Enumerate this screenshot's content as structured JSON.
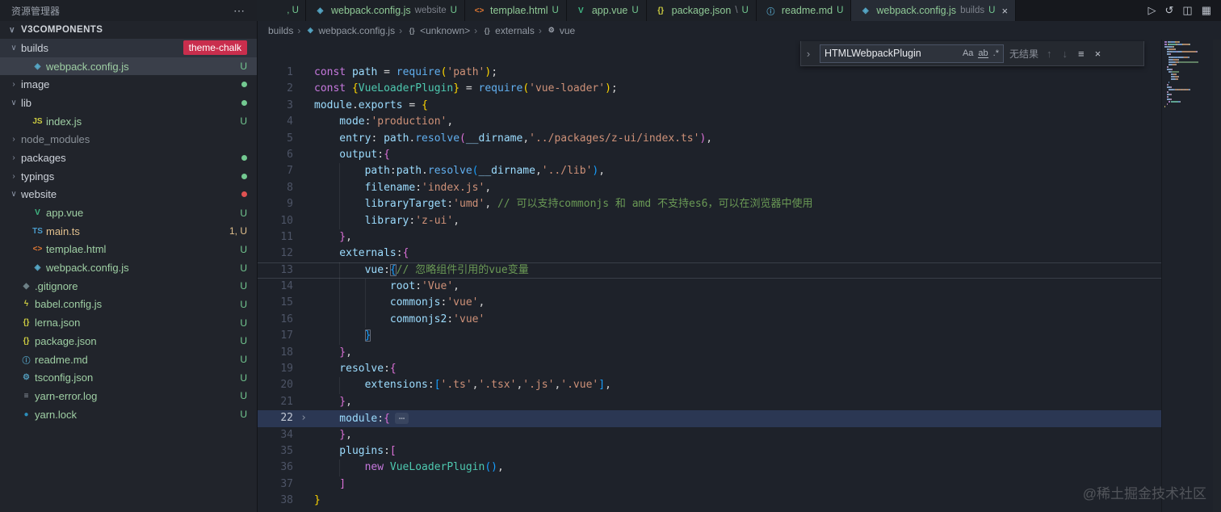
{
  "titlebar": {
    "explorer_title": "资源管理器",
    "more_icon": "⋯"
  },
  "icons_ui": {
    "chevron_down": "∨",
    "chevron_right": "›"
  },
  "icons": {
    "webpack": {
      "glyph": "◈",
      "color": "#56a8c7"
    },
    "html": {
      "glyph": "<>",
      "color": "#e37933"
    },
    "vue": {
      "glyph": "V",
      "color": "#41b883"
    },
    "js": {
      "glyph": "JS",
      "color": "#cbcb41"
    },
    "ts": {
      "glyph": "TS",
      "color": "#4a9ccc"
    },
    "json": {
      "glyph": "{}",
      "color": "#cbcb41"
    },
    "md": {
      "glyph": "ⓘ",
      "color": "#519aba"
    },
    "git": {
      "glyph": "◆",
      "color": "#6d8086"
    },
    "babel": {
      "glyph": "ϟ",
      "color": "#cbcb41"
    },
    "tsconfig": {
      "glyph": "⚙",
      "color": "#519aba"
    },
    "log": {
      "glyph": "≡",
      "color": "#8f98a3"
    },
    "lock": {
      "glyph": "●",
      "color": "#2c8ebb"
    },
    "sym": {
      "glyph": "{}",
      "color": "#8a9199"
    },
    "wrench": {
      "glyph": "⚙",
      "color": "#9aa0ab"
    }
  },
  "tabs": [
    {
      "name": "",
      "badge": ", U",
      "partial": true
    },
    {
      "icon": "webpack",
      "name": "webpack.config.js",
      "hint": "website",
      "badge": "U"
    },
    {
      "icon": "html",
      "name": "templae.html",
      "badge": "U"
    },
    {
      "icon": "vue",
      "name": "app.vue",
      "badge": "U"
    },
    {
      "icon": "json",
      "name": "package.json",
      "hint": "\\",
      "badge": "U"
    },
    {
      "icon": "md",
      "name": "readme.md",
      "badge": "U"
    },
    {
      "icon": "webpack",
      "name": "webpack.config.js",
      "hint": "builds",
      "badge": "U",
      "active": true,
      "close": "×"
    }
  ],
  "editor_actions": [
    {
      "name": "run",
      "glyph": "▷"
    },
    {
      "name": "history",
      "glyph": "↺"
    },
    {
      "name": "split-editor",
      "glyph": "◫"
    },
    {
      "name": "layout",
      "glyph": "▦"
    }
  ],
  "explorer": {
    "project": "V3COMPONENTS",
    "items": [
      {
        "kind": "folder",
        "name": "builds",
        "expanded": true,
        "hover": true,
        "label_badge": "theme-chalk"
      },
      {
        "kind": "file",
        "icon": "webpack",
        "name": "webpack.config.js",
        "badge": "U",
        "selected": true,
        "indent": 1
      },
      {
        "kind": "folder",
        "name": "image",
        "dot": "green"
      },
      {
        "kind": "folder",
        "name": "lib",
        "expanded": true,
        "dot": "green"
      },
      {
        "kind": "file",
        "icon": "js",
        "name": "index.js",
        "badge": "U",
        "indent": 1
      },
      {
        "kind": "folder",
        "name": "node_modules",
        "muted": true
      },
      {
        "kind": "folder",
        "name": "packages",
        "dot": "green"
      },
      {
        "kind": "folder",
        "name": "typings",
        "dot": "green"
      },
      {
        "kind": "folder",
        "name": "website",
        "expanded": true,
        "dot": "red"
      },
      {
        "kind": "file",
        "icon": "vue",
        "name": "app.vue",
        "badge": "U",
        "indent": 1
      },
      {
        "kind": "file",
        "icon": "ts",
        "name": "main.ts",
        "badge": "1, U",
        "warn": true,
        "indent": 1
      },
      {
        "kind": "file",
        "icon": "html",
        "name": "templae.html",
        "badge": "U",
        "indent": 1
      },
      {
        "kind": "file",
        "icon": "webpack",
        "name": "webpack.config.js",
        "badge": "U",
        "indent": 1
      },
      {
        "kind": "file",
        "icon": "git",
        "name": ".gitignore",
        "badge": "U"
      },
      {
        "kind": "file",
        "icon": "babel",
        "name": "babel.config.js",
        "badge": "U"
      },
      {
        "kind": "file",
        "icon": "json",
        "name": "lerna.json",
        "badge": "U"
      },
      {
        "kind": "file",
        "icon": "json",
        "name": "package.json",
        "badge": "U"
      },
      {
        "kind": "file",
        "icon": "md",
        "name": "readme.md",
        "badge": "U"
      },
      {
        "kind": "file",
        "icon": "tsconfig",
        "name": "tsconfig.json",
        "badge": "U"
      },
      {
        "kind": "file",
        "icon": "log",
        "name": "yarn-error.log",
        "badge": "U"
      },
      {
        "kind": "file",
        "icon": "lock",
        "name": "yarn.lock",
        "badge": "U"
      }
    ]
  },
  "breadcrumbs": {
    "separator": "›",
    "items": [
      {
        "label": "builds"
      },
      {
        "label": "webpack.config.js",
        "icon": "webpack"
      },
      {
        "label": "<unknown>",
        "icon": "sym"
      },
      {
        "label": "externals",
        "icon": "sym"
      },
      {
        "label": "vue",
        "icon": "wrench"
      }
    ]
  },
  "find": {
    "expand": "›",
    "query": "HTMLWebpackPlugin",
    "match_case": "Aa",
    "whole_word": "ab",
    "regex": ".*",
    "no_results": "无结果",
    "prev": "↑",
    "next": "↓",
    "in_selection": "≡",
    "close": "×"
  },
  "editor": {
    "lines": [
      {
        "n": 1,
        "ind": 0,
        "tokens": [
          [
            "kw",
            "const"
          ],
          [
            "pln",
            " "
          ],
          [
            "id",
            "path"
          ],
          [
            "pln",
            " = "
          ],
          [
            "fn",
            "require"
          ],
          [
            "b1",
            "("
          ],
          [
            "str",
            "'path'"
          ],
          [
            "b1",
            ")"
          ],
          [
            "pln",
            ";"
          ]
        ]
      },
      {
        "n": 2,
        "ind": 0,
        "tokens": [
          [
            "kw",
            "const"
          ],
          [
            "pln",
            " "
          ],
          [
            "b1",
            "{"
          ],
          [
            "cls",
            "VueLoaderPlugin"
          ],
          [
            "b1",
            "}"
          ],
          [
            "pln",
            " = "
          ],
          [
            "fn",
            "require"
          ],
          [
            "b1",
            "("
          ],
          [
            "str",
            "'vue-loader'"
          ],
          [
            "b1",
            ")"
          ],
          [
            "pln",
            ";"
          ]
        ]
      },
      {
        "n": 3,
        "ind": 0,
        "tokens": [
          [
            "id",
            "module"
          ],
          [
            "pln",
            "."
          ],
          [
            "id",
            "exports"
          ],
          [
            "pln",
            " = "
          ],
          [
            "b1",
            "{"
          ]
        ]
      },
      {
        "n": 4,
        "ind": 1,
        "tokens": [
          [
            "id",
            "mode"
          ],
          [
            "pln",
            ":"
          ],
          [
            "str",
            "'production'"
          ],
          [
            "pln",
            ","
          ]
        ]
      },
      {
        "n": 5,
        "ind": 1,
        "tokens": [
          [
            "id",
            "entry"
          ],
          [
            "pln",
            ": "
          ],
          [
            "id",
            "path"
          ],
          [
            "pln",
            "."
          ],
          [
            "fn",
            "resolve"
          ],
          [
            "b2",
            "("
          ],
          [
            "id",
            "__dirname"
          ],
          [
            "pln",
            ","
          ],
          [
            "str",
            "'../packages/z-ui/index.ts'"
          ],
          [
            "b2",
            ")"
          ],
          [
            "pln",
            ","
          ]
        ]
      },
      {
        "n": 6,
        "ind": 1,
        "tokens": [
          [
            "id",
            "output"
          ],
          [
            "pln",
            ":"
          ],
          [
            "b2",
            "{"
          ]
        ]
      },
      {
        "n": 7,
        "ind": 2,
        "tokens": [
          [
            "id",
            "path"
          ],
          [
            "pln",
            ":"
          ],
          [
            "id",
            "path"
          ],
          [
            "pln",
            "."
          ],
          [
            "fn",
            "resolve"
          ],
          [
            "b3",
            "("
          ],
          [
            "id",
            "__dirname"
          ],
          [
            "pln",
            ","
          ],
          [
            "str",
            "'../lib'"
          ],
          [
            "b3",
            ")"
          ],
          [
            "pln",
            ","
          ]
        ]
      },
      {
        "n": 8,
        "ind": 2,
        "tokens": [
          [
            "id",
            "filename"
          ],
          [
            "pln",
            ":"
          ],
          [
            "str",
            "'index.js'"
          ],
          [
            "pln",
            ","
          ]
        ]
      },
      {
        "n": 9,
        "ind": 2,
        "tokens": [
          [
            "id",
            "libraryTarget"
          ],
          [
            "pln",
            ":"
          ],
          [
            "str",
            "'umd'"
          ],
          [
            "pln",
            ", "
          ],
          [
            "cmt",
            "// 可以支持commonjs 和 amd 不支持es6，可以在浏览器中使用"
          ]
        ]
      },
      {
        "n": 10,
        "ind": 2,
        "tokens": [
          [
            "id",
            "library"
          ],
          [
            "pln",
            ":"
          ],
          [
            "str",
            "'z-ui'"
          ],
          [
            "pln",
            ","
          ]
        ]
      },
      {
        "n": 11,
        "ind": 1,
        "tokens": [
          [
            "b2",
            "}"
          ],
          [
            "pln",
            ","
          ]
        ]
      },
      {
        "n": 12,
        "ind": 1,
        "tokens": [
          [
            "id",
            "externals"
          ],
          [
            "pln",
            ":"
          ],
          [
            "b2",
            "{"
          ]
        ]
      },
      {
        "n": 13,
        "ind": 2,
        "border": true,
        "tokens": [
          [
            "id",
            "vue"
          ],
          [
            "pln",
            ":"
          ],
          [
            "b3 match",
            "{"
          ],
          [
            "cmt",
            "// 忽略组件引用的vue变量"
          ]
        ]
      },
      {
        "n": 14,
        "ind": 3,
        "tokens": [
          [
            "id",
            "root"
          ],
          [
            "pln",
            ":"
          ],
          [
            "str",
            "'Vue'"
          ],
          [
            "pln",
            ","
          ]
        ]
      },
      {
        "n": 15,
        "ind": 3,
        "tokens": [
          [
            "id",
            "commonjs"
          ],
          [
            "pln",
            ":"
          ],
          [
            "str",
            "'vue'"
          ],
          [
            "pln",
            ","
          ]
        ]
      },
      {
        "n": 16,
        "ind": 3,
        "tokens": [
          [
            "id",
            "commonjs2"
          ],
          [
            "pln",
            ":"
          ],
          [
            "str",
            "'vue'"
          ]
        ]
      },
      {
        "n": 17,
        "ind": 2,
        "tokens": [
          [
            "b3 match",
            "}"
          ]
        ]
      },
      {
        "n": 18,
        "ind": 1,
        "tokens": [
          [
            "b2",
            "}"
          ],
          [
            "pln",
            ","
          ]
        ]
      },
      {
        "n": 19,
        "ind": 1,
        "tokens": [
          [
            "id",
            "resolve"
          ],
          [
            "pln",
            ":"
          ],
          [
            "b2",
            "{"
          ]
        ]
      },
      {
        "n": 20,
        "ind": 2,
        "tokens": [
          [
            "id",
            "extensions"
          ],
          [
            "pln",
            ":"
          ],
          [
            "b3",
            "["
          ],
          [
            "str",
            "'.ts'"
          ],
          [
            "pln",
            ","
          ],
          [
            "str",
            "'.tsx'"
          ],
          [
            "pln",
            ","
          ],
          [
            "str",
            "'.js'"
          ],
          [
            "pln",
            ","
          ],
          [
            "str",
            "'.vue'"
          ],
          [
            "b3",
            "]"
          ],
          [
            "pln",
            ","
          ]
        ]
      },
      {
        "n": 21,
        "ind": 1,
        "tokens": [
          [
            "b2",
            "}"
          ],
          [
            "pln",
            ","
          ]
        ]
      },
      {
        "n": 22,
        "ind": 1,
        "cur": true,
        "fold": true,
        "tokens": [
          [
            "id",
            "module"
          ],
          [
            "pln",
            ":"
          ],
          [
            "b2",
            "{"
          ],
          [
            "fold",
            "⋯"
          ]
        ]
      },
      {
        "n": 34,
        "ind": 1,
        "tokens": [
          [
            "b2",
            "}"
          ],
          [
            "pln",
            ","
          ]
        ]
      },
      {
        "n": 35,
        "ind": 1,
        "tokens": [
          [
            "id",
            "plugins"
          ],
          [
            "pln",
            ":"
          ],
          [
            "b2",
            "["
          ]
        ]
      },
      {
        "n": 36,
        "ind": 2,
        "tokens": [
          [
            "kw",
            "new"
          ],
          [
            "pln",
            " "
          ],
          [
            "cls",
            "VueLoaderPlugin"
          ],
          [
            "b3",
            "("
          ],
          [
            "b3",
            ")"
          ],
          [
            "pln",
            ","
          ]
        ]
      },
      {
        "n": 37,
        "ind": 1,
        "tokens": [
          [
            "b2",
            "]"
          ]
        ]
      },
      {
        "n": 38,
        "ind": 0,
        "tokens": [
          [
            "b1",
            "}"
          ]
        ]
      }
    ]
  },
  "watermark": "@稀土掘金技术社区"
}
